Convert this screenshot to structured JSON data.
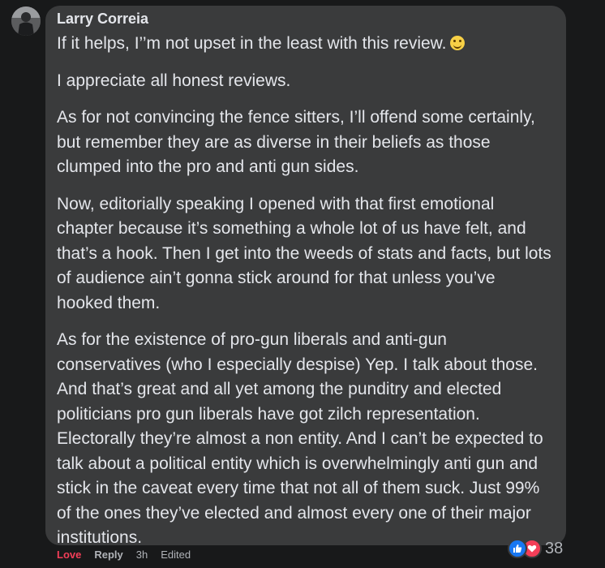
{
  "comment": {
    "author": "Larry Correia",
    "paragraphs": [
      "If it helps, I’’m not upset in the least with this review.",
      "I appreciate all honest reviews.",
      "As for not convincing the fence sitters, I’ll offend some certainly, but remember they are as diverse in their beliefs as those clumped into the pro and anti gun sides.",
      "Now, editorially speaking I opened with that first emotional chapter because it’s something a whole lot of us have felt, and that’s a hook. Then I get into the weeds of stats and facts, but lots of audience ain’t gonna stick around for that unless you’ve hooked them.",
      "As for the existence of pro-gun liberals and anti-gun conservatives (who I especially despise) Yep. I talk about those. And that’s great and all yet among the punditry and elected politicians pro gun liberals have got zilch representation. Electorally they’re almost a non entity. And I can’t be expected to talk about a political entity which is overwhelmingly anti gun and stick in the caveat every time that not all of them suck. Just 99% of the ones they’ve elected and almost every one of their major institutions."
    ],
    "emoji": "slightly-smiling-face-icon",
    "reaction_count": "38",
    "reaction_icons": [
      "like-icon",
      "love-icon"
    ]
  },
  "actions": {
    "love_label": "Love",
    "reply_label": "Reply",
    "time_label": "3h",
    "edited_label": "Edited"
  },
  "colors": {
    "background": "#18191a",
    "bubble": "#3a3b3c",
    "text": "#e4e6eb",
    "secondary_text": "#b0b3b8",
    "love": "#f33e58",
    "like": "#1877f2"
  }
}
